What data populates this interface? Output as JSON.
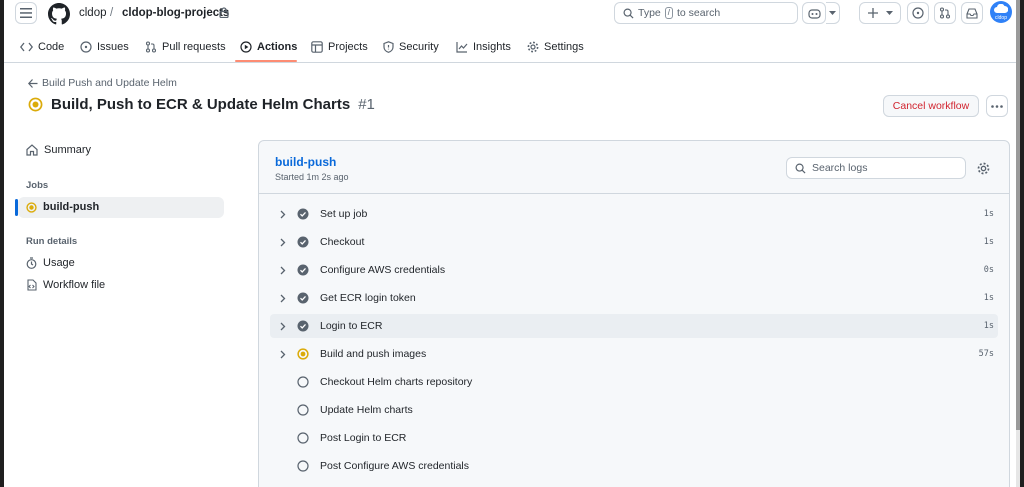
{
  "header": {
    "owner": "cldop",
    "separator": "/",
    "repo": "cldop-blog-projects",
    "search_prefix": "Type",
    "search_key": "/",
    "search_suffix": "to search",
    "avatar_text": "cldop"
  },
  "nav": {
    "tabs": [
      {
        "label": "Code"
      },
      {
        "label": "Issues"
      },
      {
        "label": "Pull requests"
      },
      {
        "label": "Actions"
      },
      {
        "label": "Projects"
      },
      {
        "label": "Security"
      },
      {
        "label": "Insights"
      },
      {
        "label": "Settings"
      }
    ],
    "active_tab": "Actions"
  },
  "run": {
    "back_label": "Build Push and Update Helm",
    "title": "Build, Push to ECR & Update Helm Charts",
    "number": "#1",
    "cancel_label": "Cancel workflow"
  },
  "sidebar": {
    "summary_label": "Summary",
    "jobs_heading": "Jobs",
    "job_label": "build-push",
    "run_details_heading": "Run details",
    "usage_label": "Usage",
    "workflow_file_label": "Workflow file"
  },
  "job": {
    "name": "build-push",
    "started": "Started 1m 2s ago",
    "search_placeholder": "Search logs",
    "steps": [
      {
        "name": "Set up job",
        "duration": "1s",
        "status": "success"
      },
      {
        "name": "Checkout",
        "duration": "1s",
        "status": "success"
      },
      {
        "name": "Configure AWS credentials",
        "duration": "0s",
        "status": "success"
      },
      {
        "name": "Get ECR login token",
        "duration": "1s",
        "status": "success"
      },
      {
        "name": "Login to ECR",
        "duration": "1s",
        "status": "success"
      },
      {
        "name": "Build and push images",
        "duration": "57s",
        "status": "in_progress"
      },
      {
        "name": "Checkout Helm charts repository",
        "duration": "",
        "status": "queued"
      },
      {
        "name": "Update Helm charts",
        "duration": "",
        "status": "queued"
      },
      {
        "name": "Post Login to ECR",
        "duration": "",
        "status": "queued"
      },
      {
        "name": "Post Configure AWS credentials",
        "duration": "",
        "status": "queued"
      }
    ]
  },
  "colors": {
    "accent": "#0969da",
    "in_progress": "#dbab0a",
    "success": "#59636e",
    "danger": "#d1242f",
    "active_tab_underline": "#fd8c73"
  }
}
